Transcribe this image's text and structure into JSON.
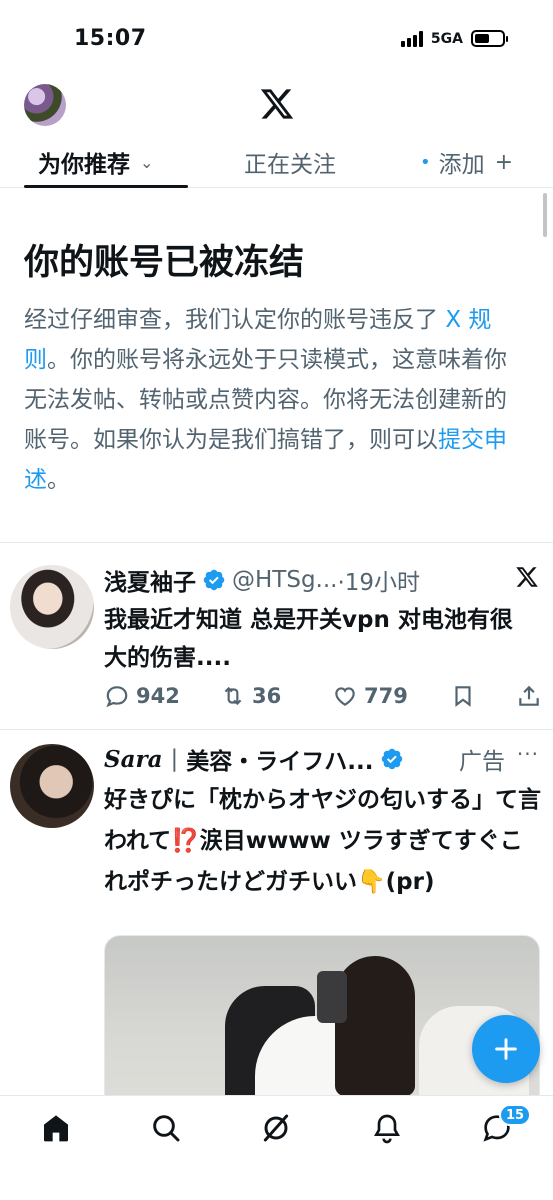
{
  "status_bar": {
    "time": "15:07",
    "network": "5GA"
  },
  "header": {
    "tabs": [
      {
        "label": "为你推荐"
      },
      {
        "label": "正在关注"
      },
      {
        "label": "添加"
      }
    ]
  },
  "notice": {
    "title": "你的账号已被冻结",
    "body_part1": "经过仔细审查，我们认定你的账号违反了 ",
    "rules_link": "X 规则",
    "body_part2": "。你的账号将永远处于只读模式，这意味着你无法发帖、转帖或点赞内容。你将无法创建新的账号。如果你认为是我们搞错了，则可以",
    "appeal_link": "提交申述",
    "body_part3": "。"
  },
  "tweets": [
    {
      "name": "浅夏袖子",
      "handle": "@HTSg...",
      "time": "·19小时",
      "text": "我最近才知道 总是开关vpn 对电池有很大的伤害....",
      "replies": "942",
      "retweets": "36",
      "likes": "779"
    },
    {
      "name_latin": "Sara",
      "name_rest": "美容・ライフハ...",
      "separator": "|",
      "ad_label": "广告",
      "more": "···",
      "text": "好きぴに「枕からオヤジの匂いする」て言われて⁉️涙目wwww ツラすぎてすぐこれポチったけどガチいい👇(pr)"
    }
  ],
  "bottom_nav": {
    "messages_badge": "15"
  },
  "icons": {
    "home": "home-icon",
    "search": "search-icon",
    "grok": "grok-icon",
    "notifications": "bell-icon",
    "messages": "messages-icon",
    "compose": "plus-icon"
  },
  "colors": {
    "accent": "#1d9bf0",
    "text": "#0f1419",
    "muted": "#536471"
  }
}
